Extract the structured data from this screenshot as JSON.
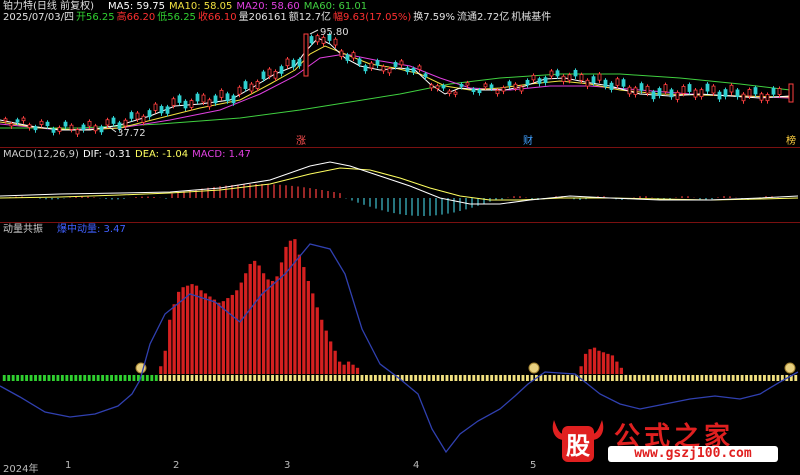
{
  "header": {
    "stock": "铂力特(日线 前复权)",
    "date": "2025/07/03/四",
    "open": "开56.25",
    "high": "高66.20",
    "low": "低56.25",
    "close": "收66.10",
    "volume": "量206161",
    "amount": "额12.7亿",
    "change": "幅9.63(17.05%)",
    "turnover": "换7.59%",
    "float": "流通2.72亿",
    "sector": "机械基件",
    "colors": {
      "white": "#e0e0e0",
      "red": "#ff3030",
      "green": "#30d030",
      "cyan": "#30d0d0",
      "magenta": "#d040d0"
    }
  },
  "ma_bar": {
    "ma5": "MA5: 59.75",
    "ma10": "MA10: 58.05",
    "ma20": "MA20: 58.60",
    "ma60": "MA60: 61.01",
    "colors": {
      "ma5": "#ffffff",
      "ma10": "#f0e040",
      "ma20": "#e040e0",
      "ma60": "#40d040"
    }
  },
  "price_panel": {
    "high_marker": "95.80",
    "low_marker": "37.72",
    "event_markers": [
      {
        "label": "涨",
        "color": "#ff5050"
      },
      {
        "label": "财",
        "color": "#40a0ff"
      },
      {
        "label": "榜",
        "color": "#ffd040"
      }
    ]
  },
  "macd_panel": {
    "title": "MACD(12,26,9)",
    "dif": "DIF: -0.31",
    "dea": "DEA: -1.04",
    "macd": "MACD: 1.47",
    "colors": {
      "title": "#cccccc",
      "dif": "#ffffff",
      "dea": "#ffff60",
      "macd": "#e040e0"
    }
  },
  "indicator_panel": {
    "title": "动量共振",
    "line_label": "爆中动量: 3.47",
    "colors": {
      "title": "#cccccc",
      "line_label": "#4060ff",
      "bars": "#d42020",
      "dots_green": "#30d030",
      "dots_yellow": "#f0e080",
      "line": "#3040b0"
    }
  },
  "x_axis": {
    "labels": [
      "2024年",
      "1",
      "2",
      "3",
      "4",
      "5"
    ]
  },
  "logo": {
    "badge_text": "股",
    "brand": "公式之家",
    "url": "www.gszj100.com"
  },
  "chart_data": {
    "type": "bar",
    "indicator_values": [
      0,
      0,
      0,
      0,
      0,
      0,
      0,
      0,
      0,
      0,
      0,
      0,
      0,
      0,
      0,
      0,
      0,
      0,
      0,
      0,
      0,
      0,
      0,
      0,
      0,
      0,
      0,
      0,
      0,
      0,
      0,
      0,
      0,
      0,
      0,
      0.5,
      1.5,
      3.5,
      4.5,
      5.3,
      5.6,
      5.7,
      5.8,
      5.7,
      5.4,
      5.2,
      5,
      4.8,
      4.6,
      4.7,
      4.9,
      5.1,
      5.4,
      5.9,
      6.5,
      7.1,
      7.3,
      7,
      6.5,
      6.1,
      6.0,
      6.3,
      7.2,
      8.2,
      8.6,
      8.7,
      7.7,
      6.9,
      6.0,
      5.2,
      4.3,
      3.5,
      2.8,
      2.1,
      1.5,
      0.8,
      0.6,
      0.8,
      0.6,
      0.4,
      0,
      0,
      0,
      0,
      0,
      0,
      0,
      0,
      0,
      0,
      0,
      0,
      0,
      0,
      0,
      0,
      0,
      0,
      0,
      0,
      0,
      0,
      0,
      0,
      0,
      0,
      0,
      0,
      0,
      0,
      0,
      0,
      0,
      0,
      0,
      0,
      0,
      0,
      0,
      0,
      0,
      0,
      0,
      0,
      0,
      0,
      0,
      0,
      0,
      0.5,
      1.3,
      1.6,
      1.7,
      1.5,
      1.4,
      1.3,
      1.2,
      0.8,
      0.4,
      0,
      0,
      0,
      0,
      0,
      0,
      0,
      0,
      0,
      0,
      0,
      0,
      0,
      0,
      0,
      0,
      0,
      0,
      0,
      0,
      0,
      0,
      0,
      0,
      0,
      0,
      0,
      0,
      0,
      0,
      0,
      0,
      0,
      0,
      0,
      0,
      0,
      0,
      0
    ],
    "series": [
      {
        "name": "爆中动量",
        "values": [
          3.47
        ]
      }
    ]
  }
}
